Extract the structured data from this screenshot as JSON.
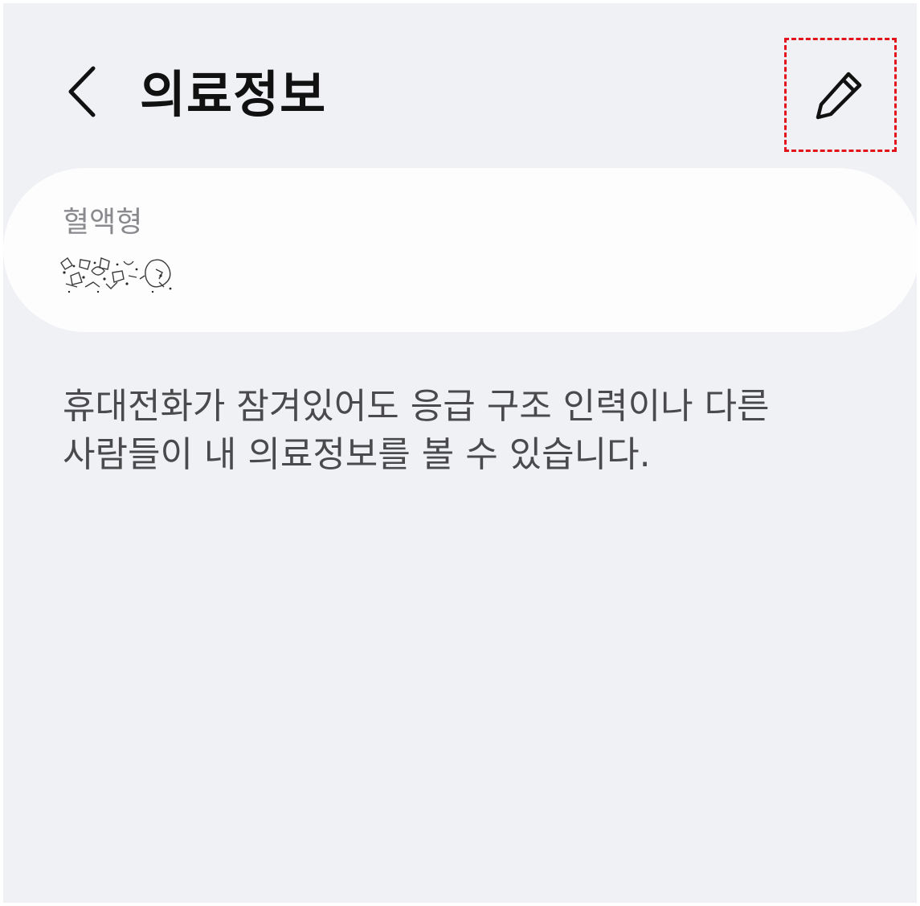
{
  "header": {
    "title": "의료정보",
    "back_icon": "chevron-left-icon",
    "edit_icon": "pencil-icon",
    "highlight_color": "#e3131b"
  },
  "card": {
    "blood_type_label": "혈액형"
  },
  "description": {
    "line1": "휴대전화가 잠겨있어도 응급 구조 인력이나 다른",
    "line2": "사람들이 내 의료정보를 볼 수 있습니다."
  },
  "colors": {
    "background": "#f0f1f5",
    "card": "#fdfdfd",
    "title": "#111111",
    "label": "#8a8a8e",
    "body_text": "#4a4a4c"
  }
}
